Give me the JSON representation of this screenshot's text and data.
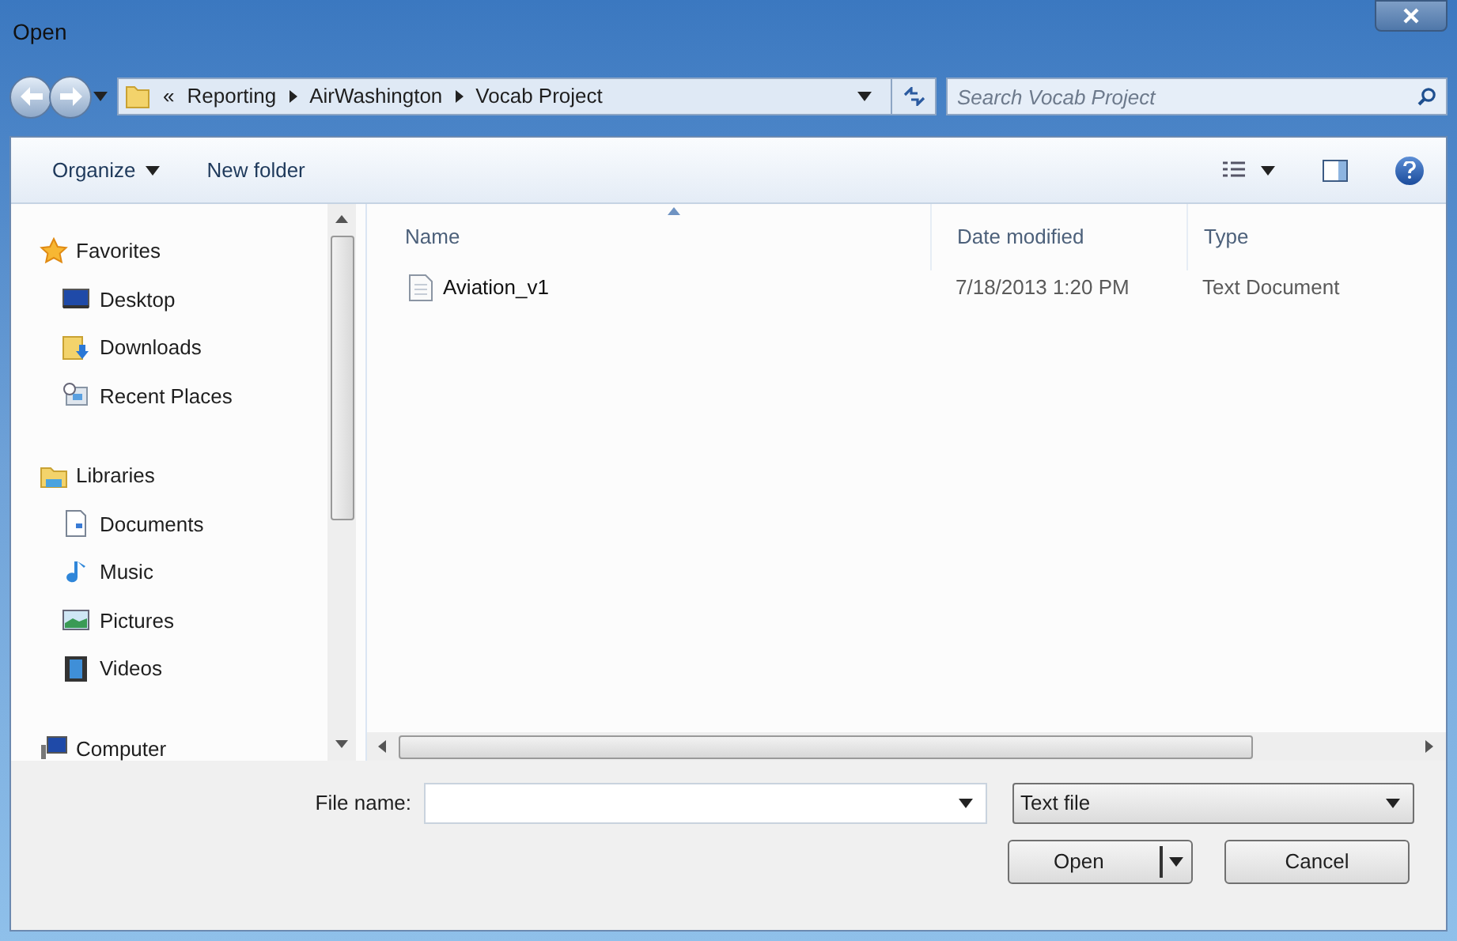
{
  "window": {
    "title": "Open"
  },
  "address": {
    "overflow": "«",
    "crumbs": [
      "Reporting",
      "AirWashington",
      "Vocab Project"
    ]
  },
  "search": {
    "placeholder": "Search Vocab Project"
  },
  "toolbar": {
    "buttons": [
      "Organize",
      "New folder"
    ]
  },
  "sidebar": {
    "groups": [
      {
        "label": "Favorites",
        "kind": "star",
        "children": [
          {
            "label": "Desktop",
            "kind": "desktop"
          },
          {
            "label": "Downloads",
            "kind": "downloads"
          },
          {
            "label": "Recent Places",
            "kind": "recent"
          }
        ]
      },
      {
        "label": "Libraries",
        "kind": "library",
        "children": [
          {
            "label": "Documents",
            "kind": "document"
          },
          {
            "label": "Music",
            "kind": "music"
          },
          {
            "label": "Pictures",
            "kind": "pictures"
          },
          {
            "label": "Videos",
            "kind": "videos"
          }
        ]
      },
      {
        "label": "Computer",
        "kind": "computer"
      }
    ]
  },
  "table": {
    "columns": [
      "Name",
      "Date modified",
      "Type"
    ],
    "rows": [
      {
        "name": "Aviation_v1",
        "date": "7/18/2013 1:20 PM",
        "type": "Text Document"
      }
    ]
  },
  "footer": {
    "file_name_label": "File name:",
    "file_type": "Text file",
    "buttons": [
      "Open",
      "Cancel"
    ]
  }
}
